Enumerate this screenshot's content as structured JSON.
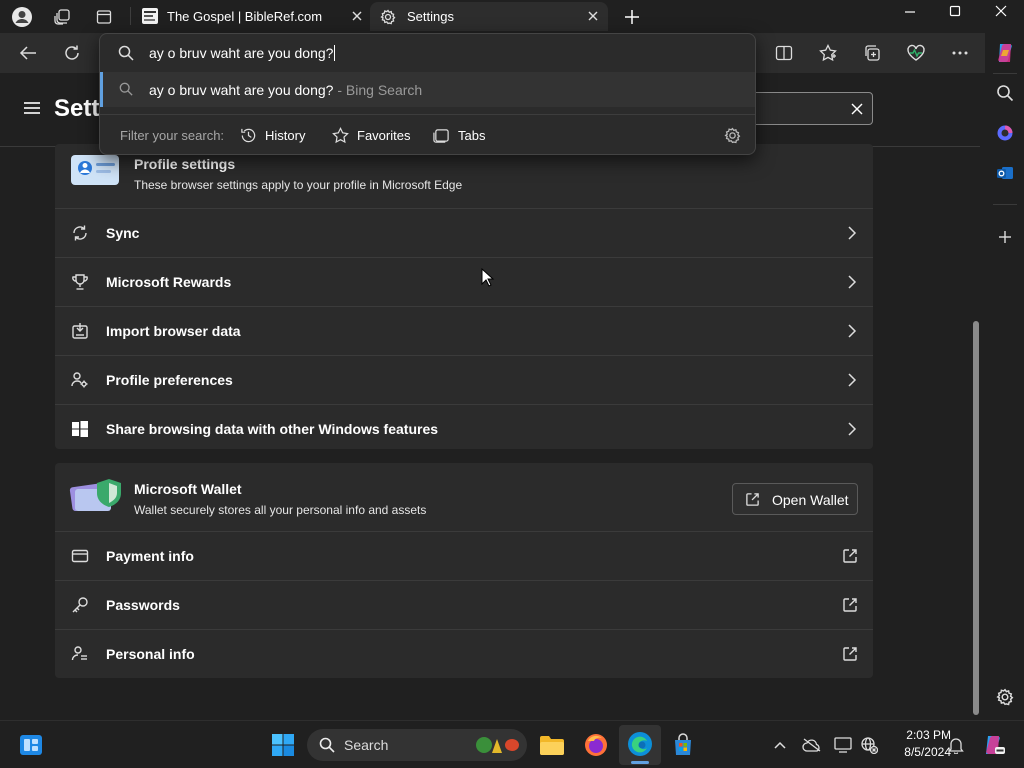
{
  "tabs": [
    {
      "title": "The Gospel | BibleRef.com",
      "active": false
    },
    {
      "title": "Settings",
      "active": true
    }
  ],
  "omnibox": {
    "query": "ay o bruv waht are you dong?",
    "suggestion_text": "ay o bruv waht are you dong?",
    "suggestion_source": " - Bing Search",
    "filter_label": "Filter your search:",
    "filters": [
      "History",
      "Favorites",
      "Tabs"
    ]
  },
  "settings": {
    "page_title": "Settings",
    "profile_card": {
      "title": "Profile settings",
      "subtitle": "These browser settings apply to your profile in Microsoft Edge"
    },
    "profile_rows": [
      {
        "label": "Sync",
        "icon": "sync-icon"
      },
      {
        "label": "Microsoft Rewards",
        "icon": "trophy-icon"
      },
      {
        "label": "Import browser data",
        "icon": "import-icon"
      },
      {
        "label": "Profile preferences",
        "icon": "people-settings-icon"
      },
      {
        "label": "Share browsing data with other Windows features",
        "icon": "windows-icon"
      }
    ],
    "wallet_card": {
      "title": "Microsoft Wallet",
      "subtitle": "Wallet securely stores all your personal info and assets",
      "button": "Open Wallet"
    },
    "wallet_rows": [
      {
        "label": "Payment info",
        "icon": "card-icon"
      },
      {
        "label": "Passwords",
        "icon": "key-icon"
      },
      {
        "label": "Personal info",
        "icon": "person-info-icon"
      }
    ]
  },
  "taskbar": {
    "search_label": "Search",
    "time": "2:03 PM",
    "date": "8/5/2024"
  },
  "colors": {
    "accent": "#60a0e0",
    "card_bg": "#2b2b2b",
    "page_bg": "#202020"
  }
}
